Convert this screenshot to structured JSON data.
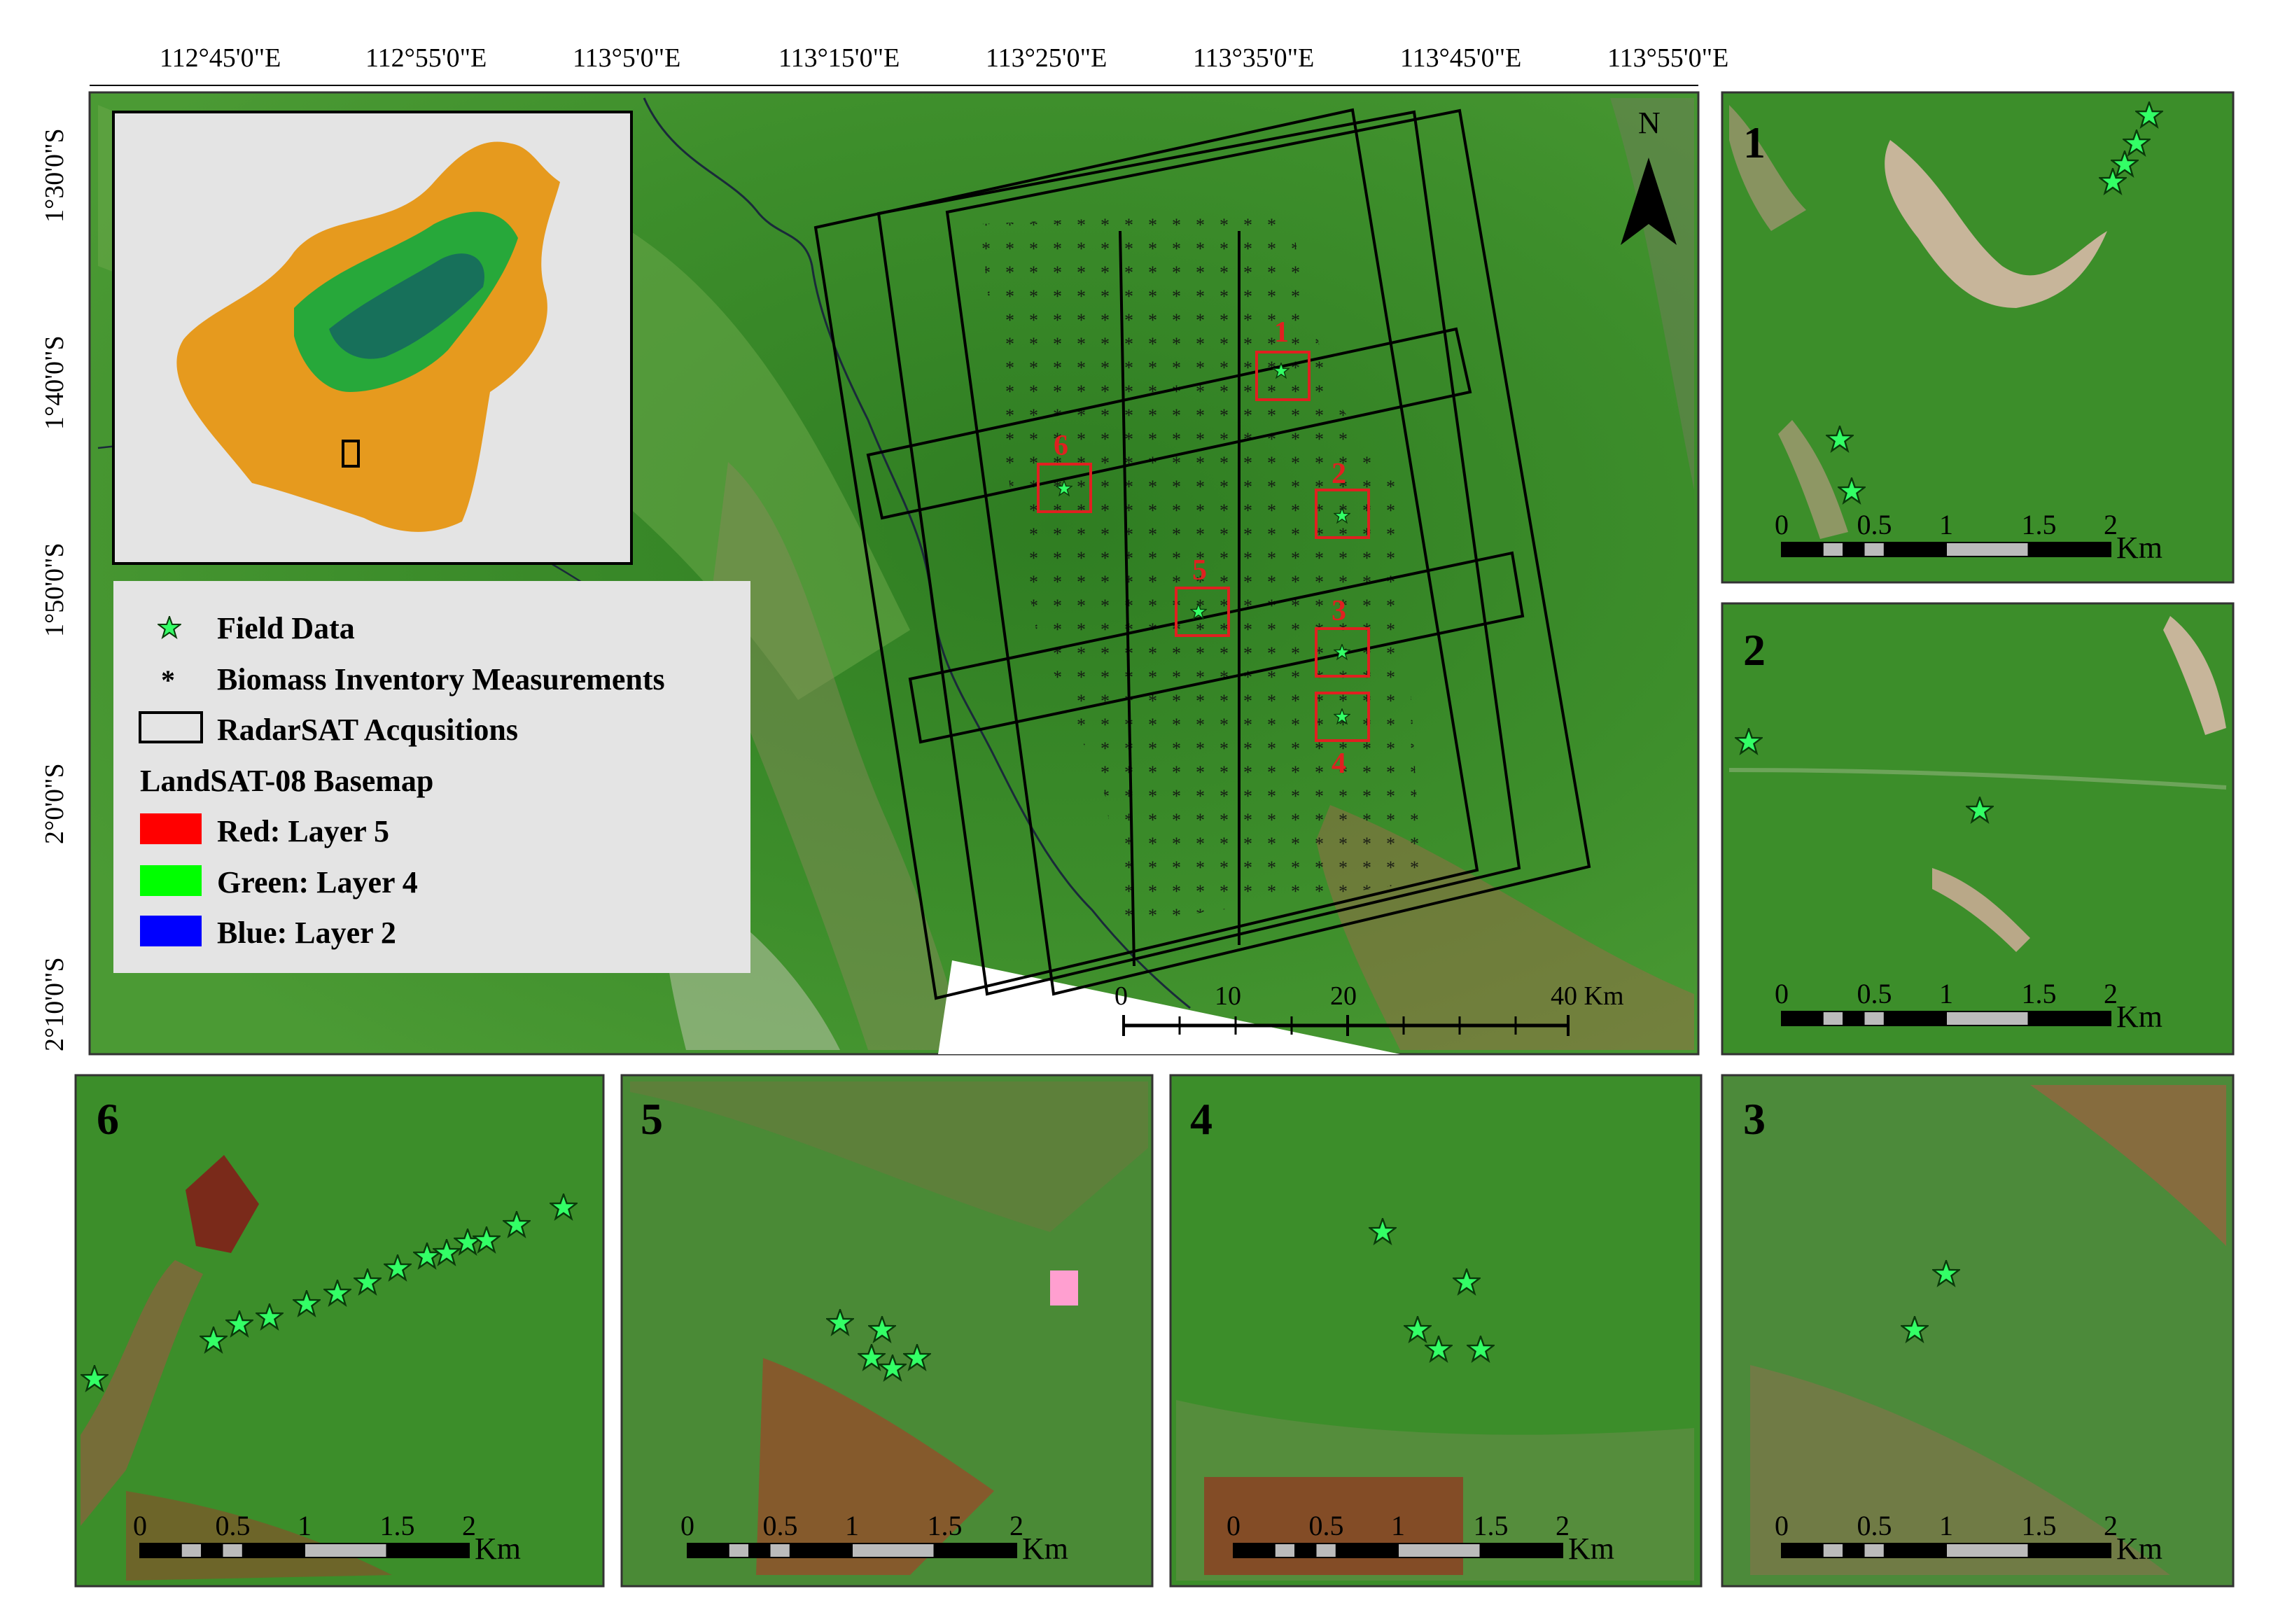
{
  "figure": {
    "top_axis_labels": [
      "112°45'0\"E",
      "112°55'0\"E",
      "113°5'0\"E",
      "113°15'0\"E",
      "113°25'0\"E",
      "113°35'0\"E",
      "113°45'0\"E",
      "113°55'0\"E"
    ],
    "left_axis_labels": [
      "1°30'0\"S",
      "1°40'0\"S",
      "1°50'0\"S",
      "2°0'0\"S",
      "2°10'0\"S"
    ],
    "north_label": "N",
    "main_scale": {
      "ticks": [
        "0",
        "10",
        "20",
        "40 Km"
      ]
    },
    "inset_box_labels": [
      "1",
      "2",
      "3",
      "4",
      "5",
      "6"
    ],
    "legend": {
      "field_data": "Field Data",
      "biomass": "Biomass Inventory Measurements",
      "radarsat": "RadarSAT Acqusitions",
      "basemap_title": "LandSAT-08 Basemap",
      "bands": [
        {
          "label": "Red:    Layer 5",
          "color": "#ff0000"
        },
        {
          "label": "Green: Layer 4",
          "color": "#00ff00"
        },
        {
          "label": "Blue:   Layer 2",
          "color": "#0000ff"
        }
      ]
    },
    "panels": [
      {
        "id": "1"
      },
      {
        "id": "2"
      },
      {
        "id": "3"
      },
      {
        "id": "4"
      },
      {
        "id": "5"
      },
      {
        "id": "6"
      }
    ],
    "panel_scale": {
      "ticks": [
        "0",
        "0.5",
        "1",
        "1.5",
        "2"
      ],
      "unit": "Km"
    },
    "colors": {
      "vegetation": "#3f8f2c",
      "deep_forest": "#2e7a24",
      "cleared": "#a0694a",
      "star_fill": "#33ff66",
      "box_red": "#e02020",
      "borneo_orange": "#e69a1e",
      "borneo_green": "#27a83a",
      "borneo_dark": "#17705a"
    }
  }
}
